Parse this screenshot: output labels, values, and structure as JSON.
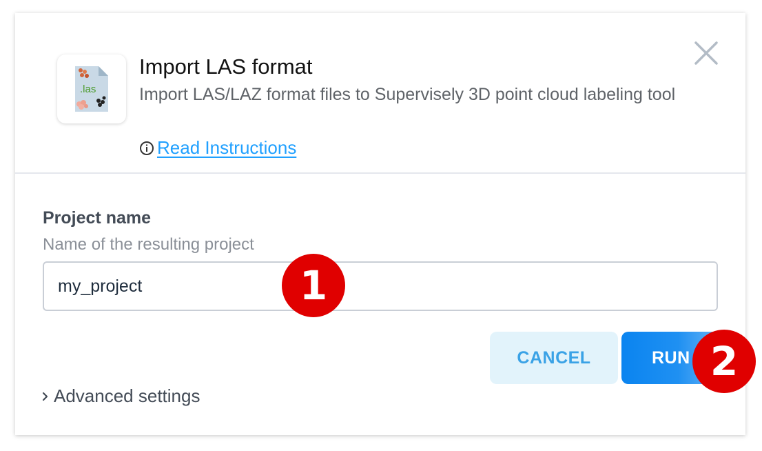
{
  "app": {
    "title": "Import LAS format",
    "description": "Import LAS/LAZ format files to Supervisely 3D point cloud labeling tool",
    "icon": "las-file-icon",
    "icon_label": ".las",
    "read_instructions": " Read Instructions"
  },
  "form": {
    "project_label": "Project name",
    "project_help": "Name of the resulting project",
    "project_value": "my_project",
    "advanced_label": "Advanced settings"
  },
  "buttons": {
    "cancel": "CANCEL",
    "run": "RUN"
  },
  "annotations": {
    "step1": "1",
    "step2": "2"
  },
  "colors": {
    "accent": "#20a0ff",
    "run_button": "#0a84f0",
    "cancel_bg": "#e2f3fb",
    "badge": "#e00000"
  }
}
